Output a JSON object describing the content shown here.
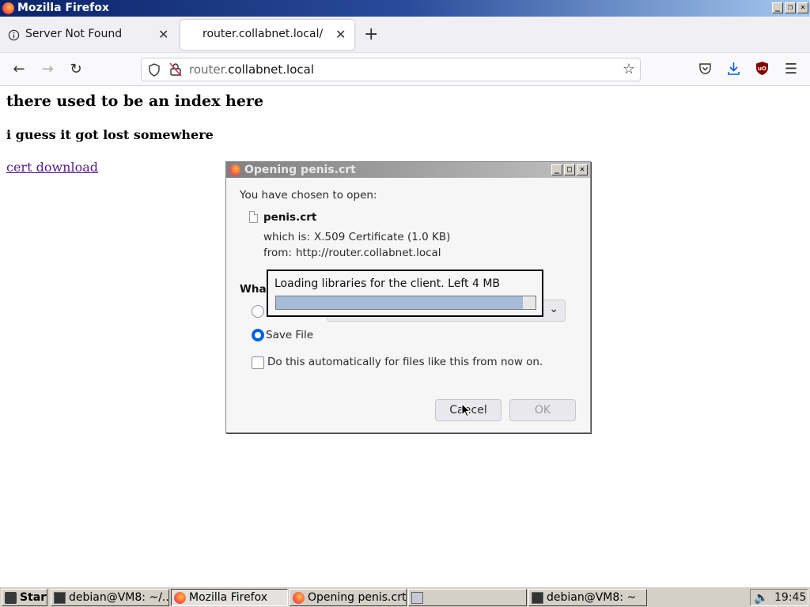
{
  "window": {
    "title": "Mozilla Firefox",
    "buttons": [
      "_",
      "❐",
      "✕"
    ]
  },
  "tabs": [
    {
      "label": "Server Not Found",
      "icon": "info-icon",
      "active": false
    },
    {
      "label": "router.collabnet.local/",
      "icon": "",
      "active": true
    }
  ],
  "toolbar": {
    "url_dim": "router.",
    "url_main": "collabnet.local"
  },
  "page": {
    "heading1": "there used to be an index here",
    "heading2": "i guess it got lost somewhere",
    "link": "cert download"
  },
  "dialog": {
    "title": "Opening penis.crt",
    "chosen": "You have chosen to open:",
    "filename": "penis.crt",
    "which_is_label": "which is:",
    "which_is_value": "X.509 Certificate (1.0 KB)",
    "from_label": "from:",
    "from_value": "http://router.collabnet.local",
    "question_partial": "Wha",
    "save_file": "Save File",
    "save_file_selected": true,
    "auto_checkbox": "Do this automatically for files like this from now on.",
    "cancel": "Cancel",
    "ok": "OK"
  },
  "loading": {
    "message": "Loading libraries for the client. Left 4 MB",
    "progress": 0.95
  },
  "taskbar": {
    "start": "Start",
    "tasks": [
      "debian@VM8: ~/...",
      "Mozilla Firefox",
      "Opening penis.crt",
      "",
      "debian@VM8: ~"
    ],
    "clock": "19:45"
  }
}
